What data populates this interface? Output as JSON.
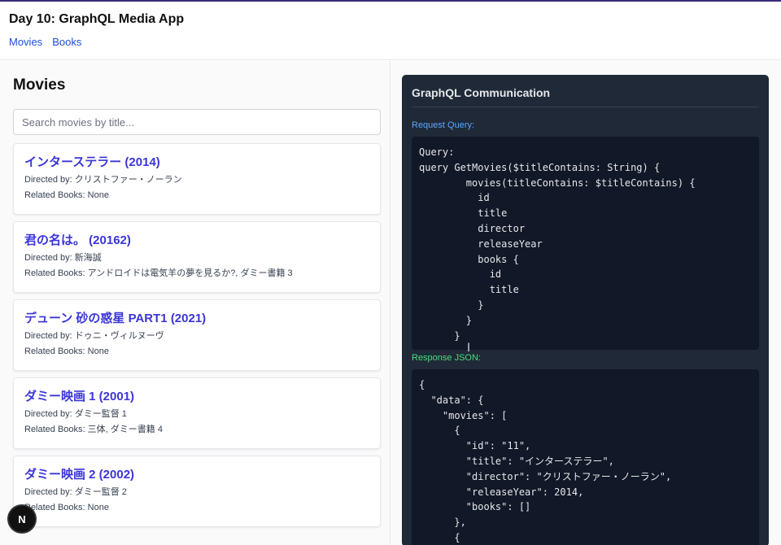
{
  "header": {
    "title": "Day 10: GraphQL Media App",
    "nav": [
      "Movies",
      "Books"
    ]
  },
  "page": {
    "title": "Movies",
    "search_placeholder": "Search movies by title..."
  },
  "movies": [
    {
      "title": "インターステラー (2014)",
      "director": "Directed by: クリストファー・ノーラン",
      "books": "Related Books: None"
    },
    {
      "title": "君の名は。 (20162)",
      "director": "Directed by: 新海誠",
      "books": "Related Books: アンドロイドは電気羊の夢を見るか?, ダミー書籍 3"
    },
    {
      "title": "デューン 砂の惑星 PART1 (2021)",
      "director": "Directed by: ドゥニ・ヴィルヌーヴ",
      "books": "Related Books: None"
    },
    {
      "title": "ダミー映画 1 (2001)",
      "director": "Directed by: ダミー監督 1",
      "books": "Related Books: 三体, ダミー書籍 4"
    },
    {
      "title": "ダミー映画 2 (2002)",
      "director": "Directed by: ダミー監督 2",
      "books": "Related Books: None"
    }
  ],
  "panel": {
    "title": "GraphQL Communication",
    "request_label": "Request Query:",
    "request_code": "Query:\nquery GetMovies($titleContains: String) {\n        movies(titleContains: $titleContains) {\n          id\n          title\n          director\n          releaseYear\n          books {\n            id\n            title\n          }\n        }\n      }",
    "response_label": "Response JSON:",
    "response_code": "{\n  \"data\": {\n    \"movies\": [\n      {\n        \"id\": \"11\",\n        \"title\": \"インターステラー\",\n        \"director\": \"クリストファー・ノーラン\",\n        \"releaseYear\": 2014,\n        \"books\": []\n      },\n      {"
  },
  "floating": {
    "badge": "N"
  },
  "colors": {
    "movie_title": "#3b35d8",
    "link": "#1d4ed8",
    "panel_bg": "#1f2937",
    "code_bg": "#111827",
    "request_label": "#60a5fa",
    "response_label": "#4ade80"
  }
}
